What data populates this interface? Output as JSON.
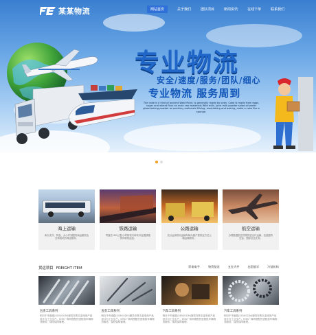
{
  "header": {
    "logo_text": "某某物流",
    "nav": [
      "网站首页",
      "关于我们",
      "团队项目",
      "新闻资讯",
      "在线下单",
      "联系我们"
    ]
  },
  "hero": {
    "title": "专业物流",
    "subtitle1": "安全/速度/服务/团队/细心",
    "subtitle2": "专业物流 服务周到",
    "description": "The cake is a kind of ancient West Point, is generally made by oven. Cake is made from eggs, sugar and wheat flour as main raw materials With milk, juice milk powder salad oil water glaze baking powder as auxiliary materials Mixing, modulating and baking, make a cake like a sponge."
  },
  "colors": {
    "brand_blue": "#1f66c8",
    "nav_active": "#2f6fd8",
    "dot_active": "#f0a020"
  },
  "services": [
    {
      "title": "海上运输",
      "desc": "承办文件、样品、大小件到国内海运服务及全球各地的海运服务。"
    },
    {
      "title": "铁路运输",
      "desc": "时速达180公里/小时特快行邮专列全国铁路快件联络运送。"
    },
    {
      "title": "公路运输",
      "desc": "充分运用现代运输车辆为客户提供全方位公路运输服务。"
    },
    {
      "title": "航空运输",
      "desc": "办理各国航空货物的进出口运输，包括国内空运，国际空运业务。"
    }
  ],
  "projects_section": {
    "title": "货运项目",
    "title_en": "FREIGHT ITEM",
    "tabs": [
      "家电电子",
      "物资配送",
      "五金大件",
      "出国留学",
      "冷链机构"
    ]
  },
  "projects": [
    {
      "title": "五金工具系列",
      "desc": "明日于市南路(OEM/ODM)服务在售五金电商产品设计与工业生产。EMS厂商同搭配的进程投车辆物流服务，保险保障管理。"
    },
    {
      "title": "五金工具系列",
      "desc": "明日于市南路(OEM/ODM)服务在售五金电商产品设计与工业生产。EMS厂商同搭配的进程投车辆物流服务，保险保障管理。"
    },
    {
      "title": "汽车工具系列",
      "desc": "明日于市南路(OEM/ODM)服务在售五金电商产品设计与工业生产。EMS厂商同搭配的进程投车辆物流服务，保险保障管理。"
    },
    {
      "title": "汽车工具系列",
      "desc": "明日于市南路(OEM/ODM)服务在售五金电商产品设计与工业生产。EMS厂商同搭配的进程投车辆物流服务，保险保障管理。"
    }
  ]
}
